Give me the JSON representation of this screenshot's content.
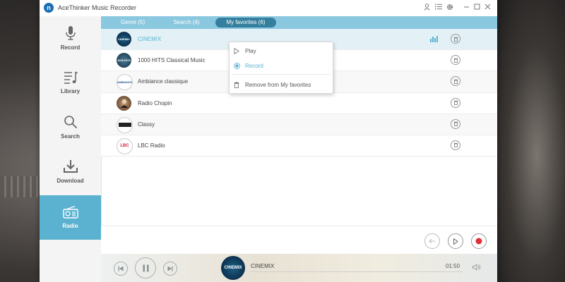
{
  "window": {
    "title": "AceThinker Music Recorder",
    "logo_letter": "n"
  },
  "titlebar_icons": [
    "user-icon",
    "menu-list-icon",
    "gear-icon",
    "minimize-icon",
    "maximize-icon",
    "close-icon"
  ],
  "sidebar": {
    "items": [
      {
        "label": "Record",
        "icon": "microphone-icon"
      },
      {
        "label": "Library",
        "icon": "music-library-icon"
      },
      {
        "label": "Search",
        "icon": "search-icon"
      },
      {
        "label": "Download",
        "icon": "download-icon"
      },
      {
        "label": "Radio",
        "icon": "radio-icon",
        "active": true
      }
    ]
  },
  "tabs": [
    {
      "label": "Genre (5)"
    },
    {
      "label": "Search (4)"
    },
    {
      "label": "My favorites (6)",
      "active": true
    }
  ],
  "stations": [
    {
      "name": "CINEMIX",
      "logo_text": "CINEMIX",
      "selected": true
    },
    {
      "name": "1000 HITS Classical Music",
      "logo_text": "1000 HITS"
    },
    {
      "name": "Ambiance classique",
      "logo_text": "AMBIANCE"
    },
    {
      "name": "Radio Chopin",
      "logo_text": ""
    },
    {
      "name": "Classy",
      "logo_text": ""
    },
    {
      "name": "LBC Radio",
      "logo_text": "LBC"
    }
  ],
  "context_menu": {
    "play": "Play",
    "record": "Record",
    "remove": "Remove from My favorites"
  },
  "now_playing": {
    "title": "CINEMIX",
    "logo_text": "CINEMIX",
    "time": "01:50"
  },
  "colors": {
    "accent": "#5ab2d0",
    "tab_bar": "#8ac8df",
    "active_tab": "#357f9e",
    "record_red": "#e0303a",
    "logo_blue": "#1d6fb3"
  }
}
